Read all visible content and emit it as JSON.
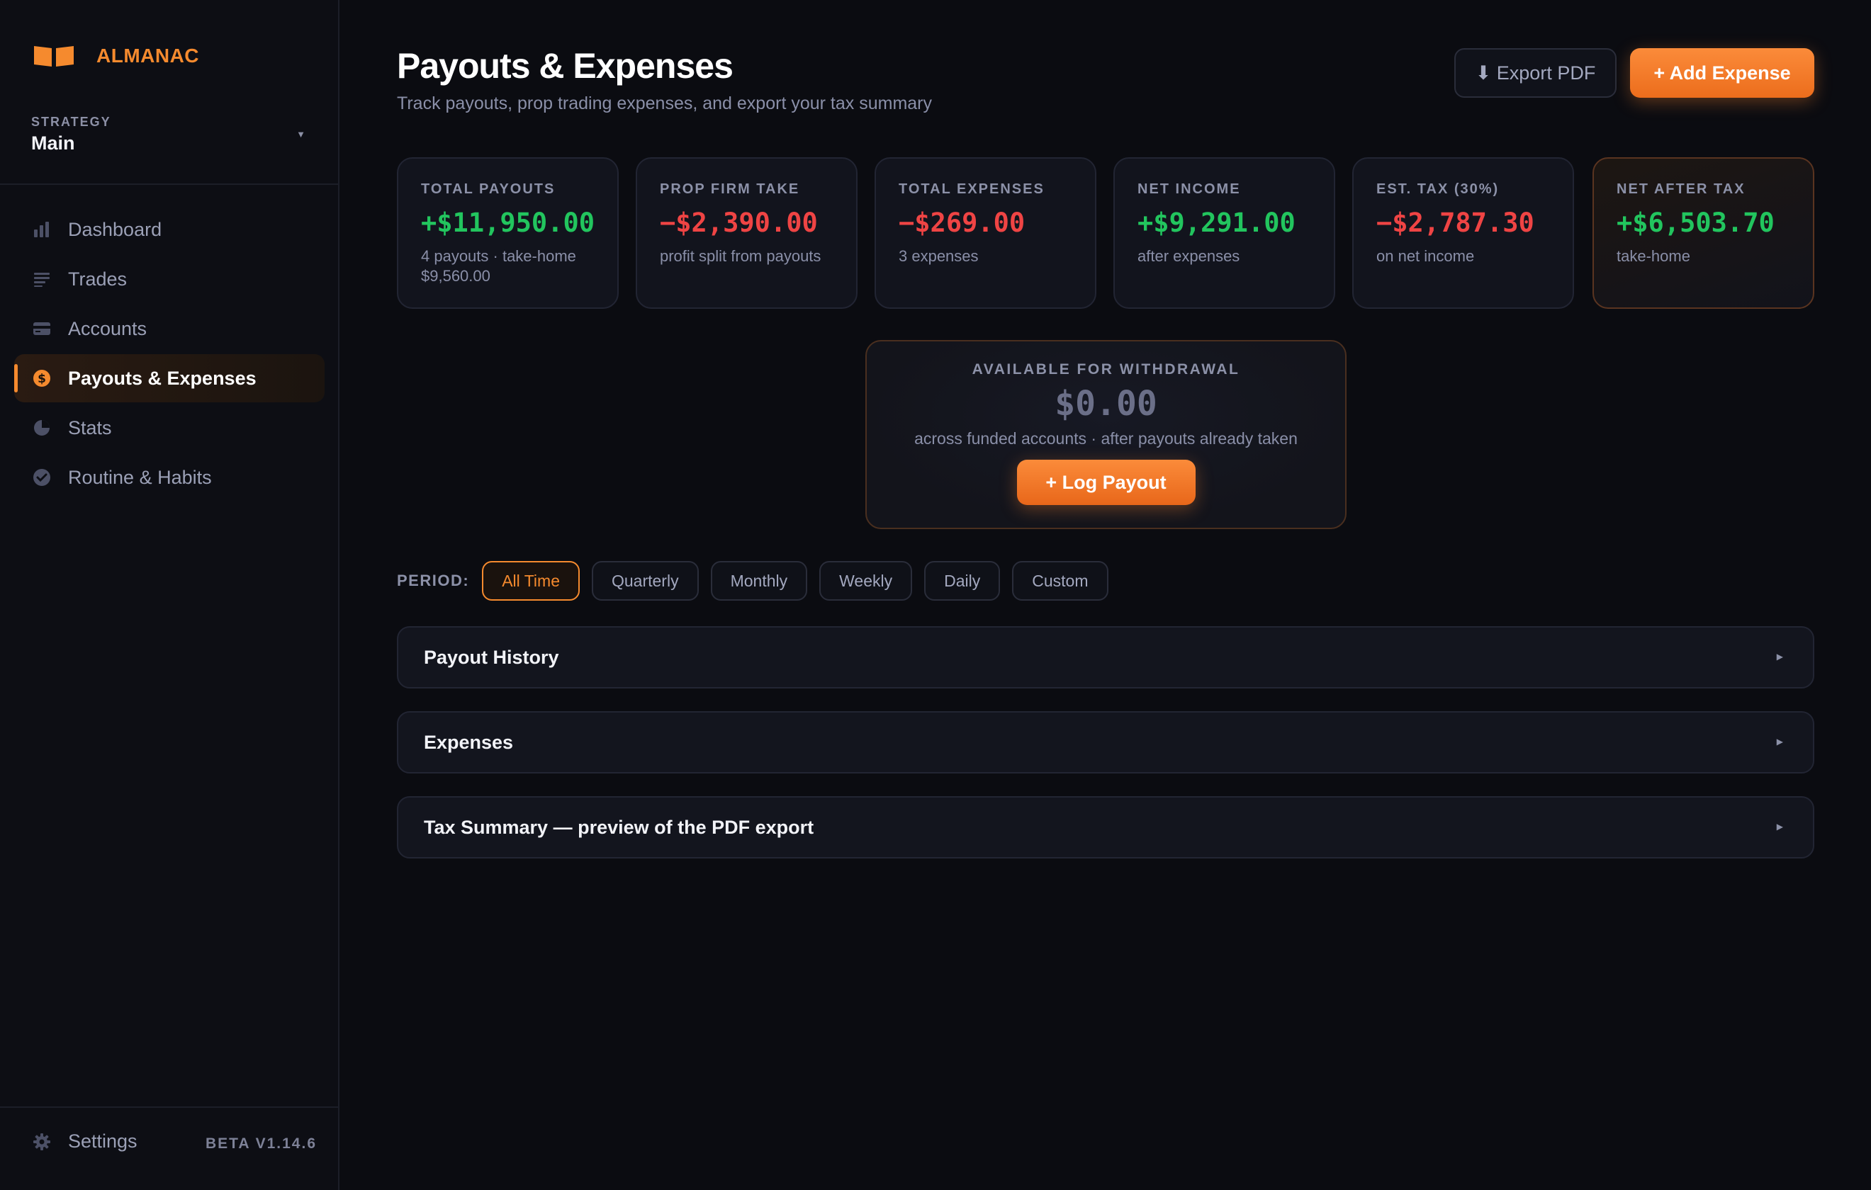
{
  "app": {
    "name": "ALMANAC",
    "version": "BETA V1.14.6"
  },
  "strategy": {
    "label": "STRATEGY",
    "value": "Main"
  },
  "nav": [
    {
      "label": "Dashboard",
      "icon": "bar-chart-icon",
      "active": false
    },
    {
      "label": "Trades",
      "icon": "list-icon",
      "active": false
    },
    {
      "label": "Accounts",
      "icon": "credit-card-icon",
      "active": false
    },
    {
      "label": "Payouts & Expenses",
      "icon": "dollar-icon",
      "active": true
    },
    {
      "label": "Stats",
      "icon": "pie-chart-icon",
      "active": false
    },
    {
      "label": "Routine & Habits",
      "icon": "check-circle-icon",
      "active": false
    }
  ],
  "settings": {
    "label": "Settings"
  },
  "header": {
    "title": "Payouts & Expenses",
    "subtitle": "Track payouts, prop trading expenses, and export your tax summary",
    "export_label": "⬇ Export PDF",
    "add_label": "+ Add Expense"
  },
  "cards": [
    {
      "label": "TOTAL PAYOUTS",
      "value": "+$11,950.00",
      "sub": "4 payouts · take-home $9,560.00",
      "tone": "pos"
    },
    {
      "label": "PROP FIRM TAKE",
      "value": "−$2,390.00",
      "sub": "profit split from payouts",
      "tone": "neg"
    },
    {
      "label": "TOTAL EXPENSES",
      "value": "−$269.00",
      "sub": "3 expenses",
      "tone": "neg"
    },
    {
      "label": "NET INCOME",
      "value": "+$9,291.00",
      "sub": "after expenses",
      "tone": "pos"
    },
    {
      "label": "EST. TAX (30%)",
      "value": "−$2,787.30",
      "sub": "on net income",
      "tone": "neg"
    },
    {
      "label": "NET AFTER TAX",
      "value": "+$6,503.70",
      "sub": "take-home",
      "tone": "pos"
    }
  ],
  "withdraw": {
    "label": "AVAILABLE FOR WITHDRAWAL",
    "value": "$0.00",
    "sub": "across funded accounts · after payouts already taken",
    "button": "+ Log Payout"
  },
  "period": {
    "label": "PERIOD:",
    "options": [
      "All Time",
      "Quarterly",
      "Monthly",
      "Weekly",
      "Daily",
      "Custom"
    ],
    "selected": "All Time"
  },
  "sections": [
    {
      "title": "Payout History"
    },
    {
      "title": "Expenses"
    },
    {
      "title": "Tax Summary — preview of the PDF export"
    }
  ],
  "colors": {
    "accent": "#f58a2e",
    "positive": "#22c55e",
    "negative": "#ef4444"
  }
}
